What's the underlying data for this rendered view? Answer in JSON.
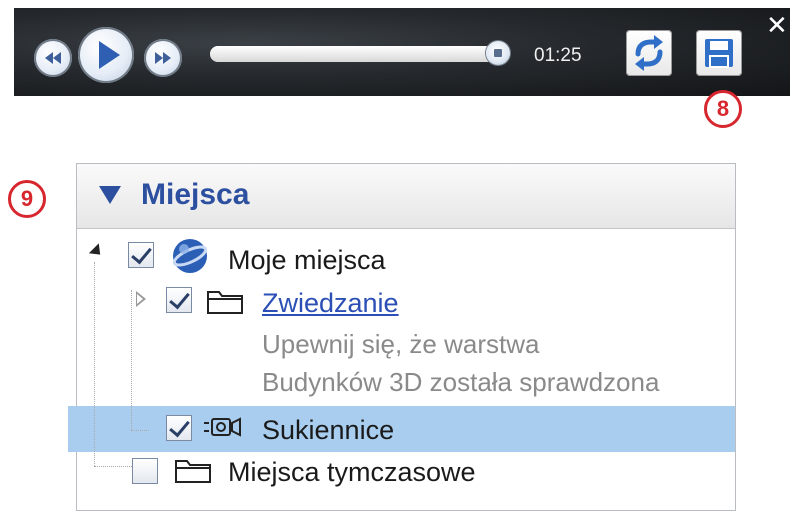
{
  "player": {
    "progress": 1.0,
    "time": "01:25",
    "icons": {
      "rewind": "rewind-icon",
      "play": "play-icon",
      "fast_forward": "fast-forward-icon",
      "repeat": "repeat-icon",
      "save": "save-icon",
      "close": "close-icon"
    },
    "close_glyph": "✕"
  },
  "callouts": {
    "save": "8",
    "places": "9"
  },
  "places_panel": {
    "title": "Miejsca",
    "items": [
      {
        "label": "Moje miejsca",
        "checked": true,
        "icon": "earth-icon"
      },
      {
        "label": "Zwiedzanie",
        "checked": true,
        "icon": "folder-icon",
        "link": true
      },
      {
        "label": "Sukiennice",
        "checked": true,
        "icon": "tour-icon",
        "selected": true
      },
      {
        "label": "Miejsca tymczasowe",
        "checked": false,
        "icon": "folder-icon"
      }
    ],
    "zwiedzanie_description": [
      "Upewnij się, że warstwa",
      "Budynków 3D została sprawdzona"
    ]
  },
  "colors": {
    "accent": "#2d4fa0",
    "callout": "#d7262d",
    "selection": "#a9cdee"
  }
}
